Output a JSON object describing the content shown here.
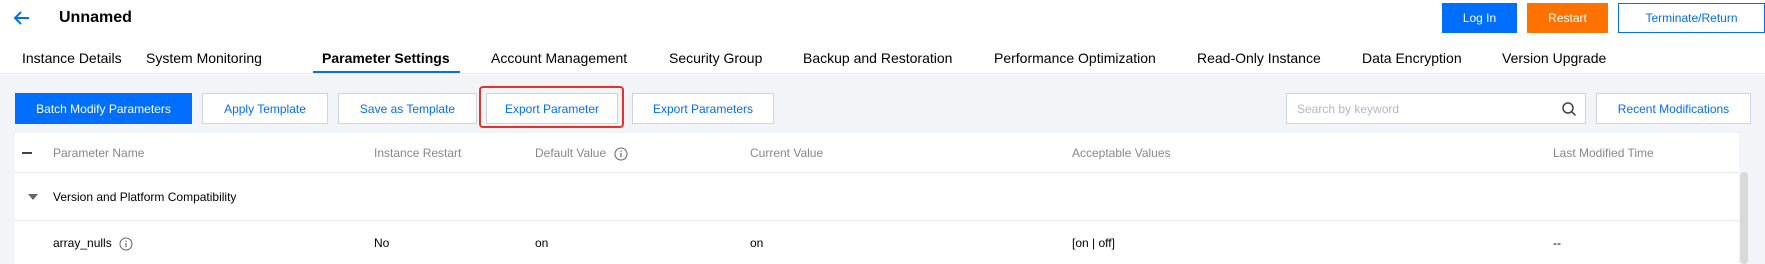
{
  "header": {
    "title": "Unnamed",
    "buttons": {
      "login": "Log In",
      "restart": "Restart",
      "terminate": "Terminate/Return"
    }
  },
  "tabs": [
    {
      "label": "Instance Details"
    },
    {
      "label": "System Monitoring"
    },
    {
      "label": "Parameter Settings",
      "active": true
    },
    {
      "label": "Account Management"
    },
    {
      "label": "Security Group"
    },
    {
      "label": "Backup and Restoration"
    },
    {
      "label": "Performance Optimization"
    },
    {
      "label": "Read-Only Instance"
    },
    {
      "label": "Data Encryption"
    },
    {
      "label": "Version Upgrade"
    }
  ],
  "toolbar": {
    "batch_modify": "Batch Modify Parameters",
    "apply_template": "Apply Template",
    "save_as_template": "Save as Template",
    "export_parameter": "Export Parameter",
    "export_parameters": "Export Parameters",
    "search_placeholder": "Search by keyword",
    "recent_modifications": "Recent Modifications"
  },
  "table": {
    "columns": {
      "name": "Parameter Name",
      "restart": "Instance Restart",
      "default": "Default Value",
      "current": "Current Value",
      "acceptable": "Acceptable Values",
      "modified": "Last Modified Time"
    },
    "group": "Version and Platform Compatibility",
    "rows": [
      {
        "name": "array_nulls",
        "restart": "No",
        "default": "on",
        "current": "on",
        "acceptable": "[on | off]",
        "modified": "--"
      }
    ]
  },
  "colors": {
    "primary": "#006eff",
    "restart": "#ff7200",
    "highlight": "#e5322d",
    "background": "#f2f4f8"
  },
  "icons": [
    "back-arrow-icon",
    "search-icon",
    "info-icon",
    "caret-down-icon",
    "collapse-all-icon"
  ]
}
